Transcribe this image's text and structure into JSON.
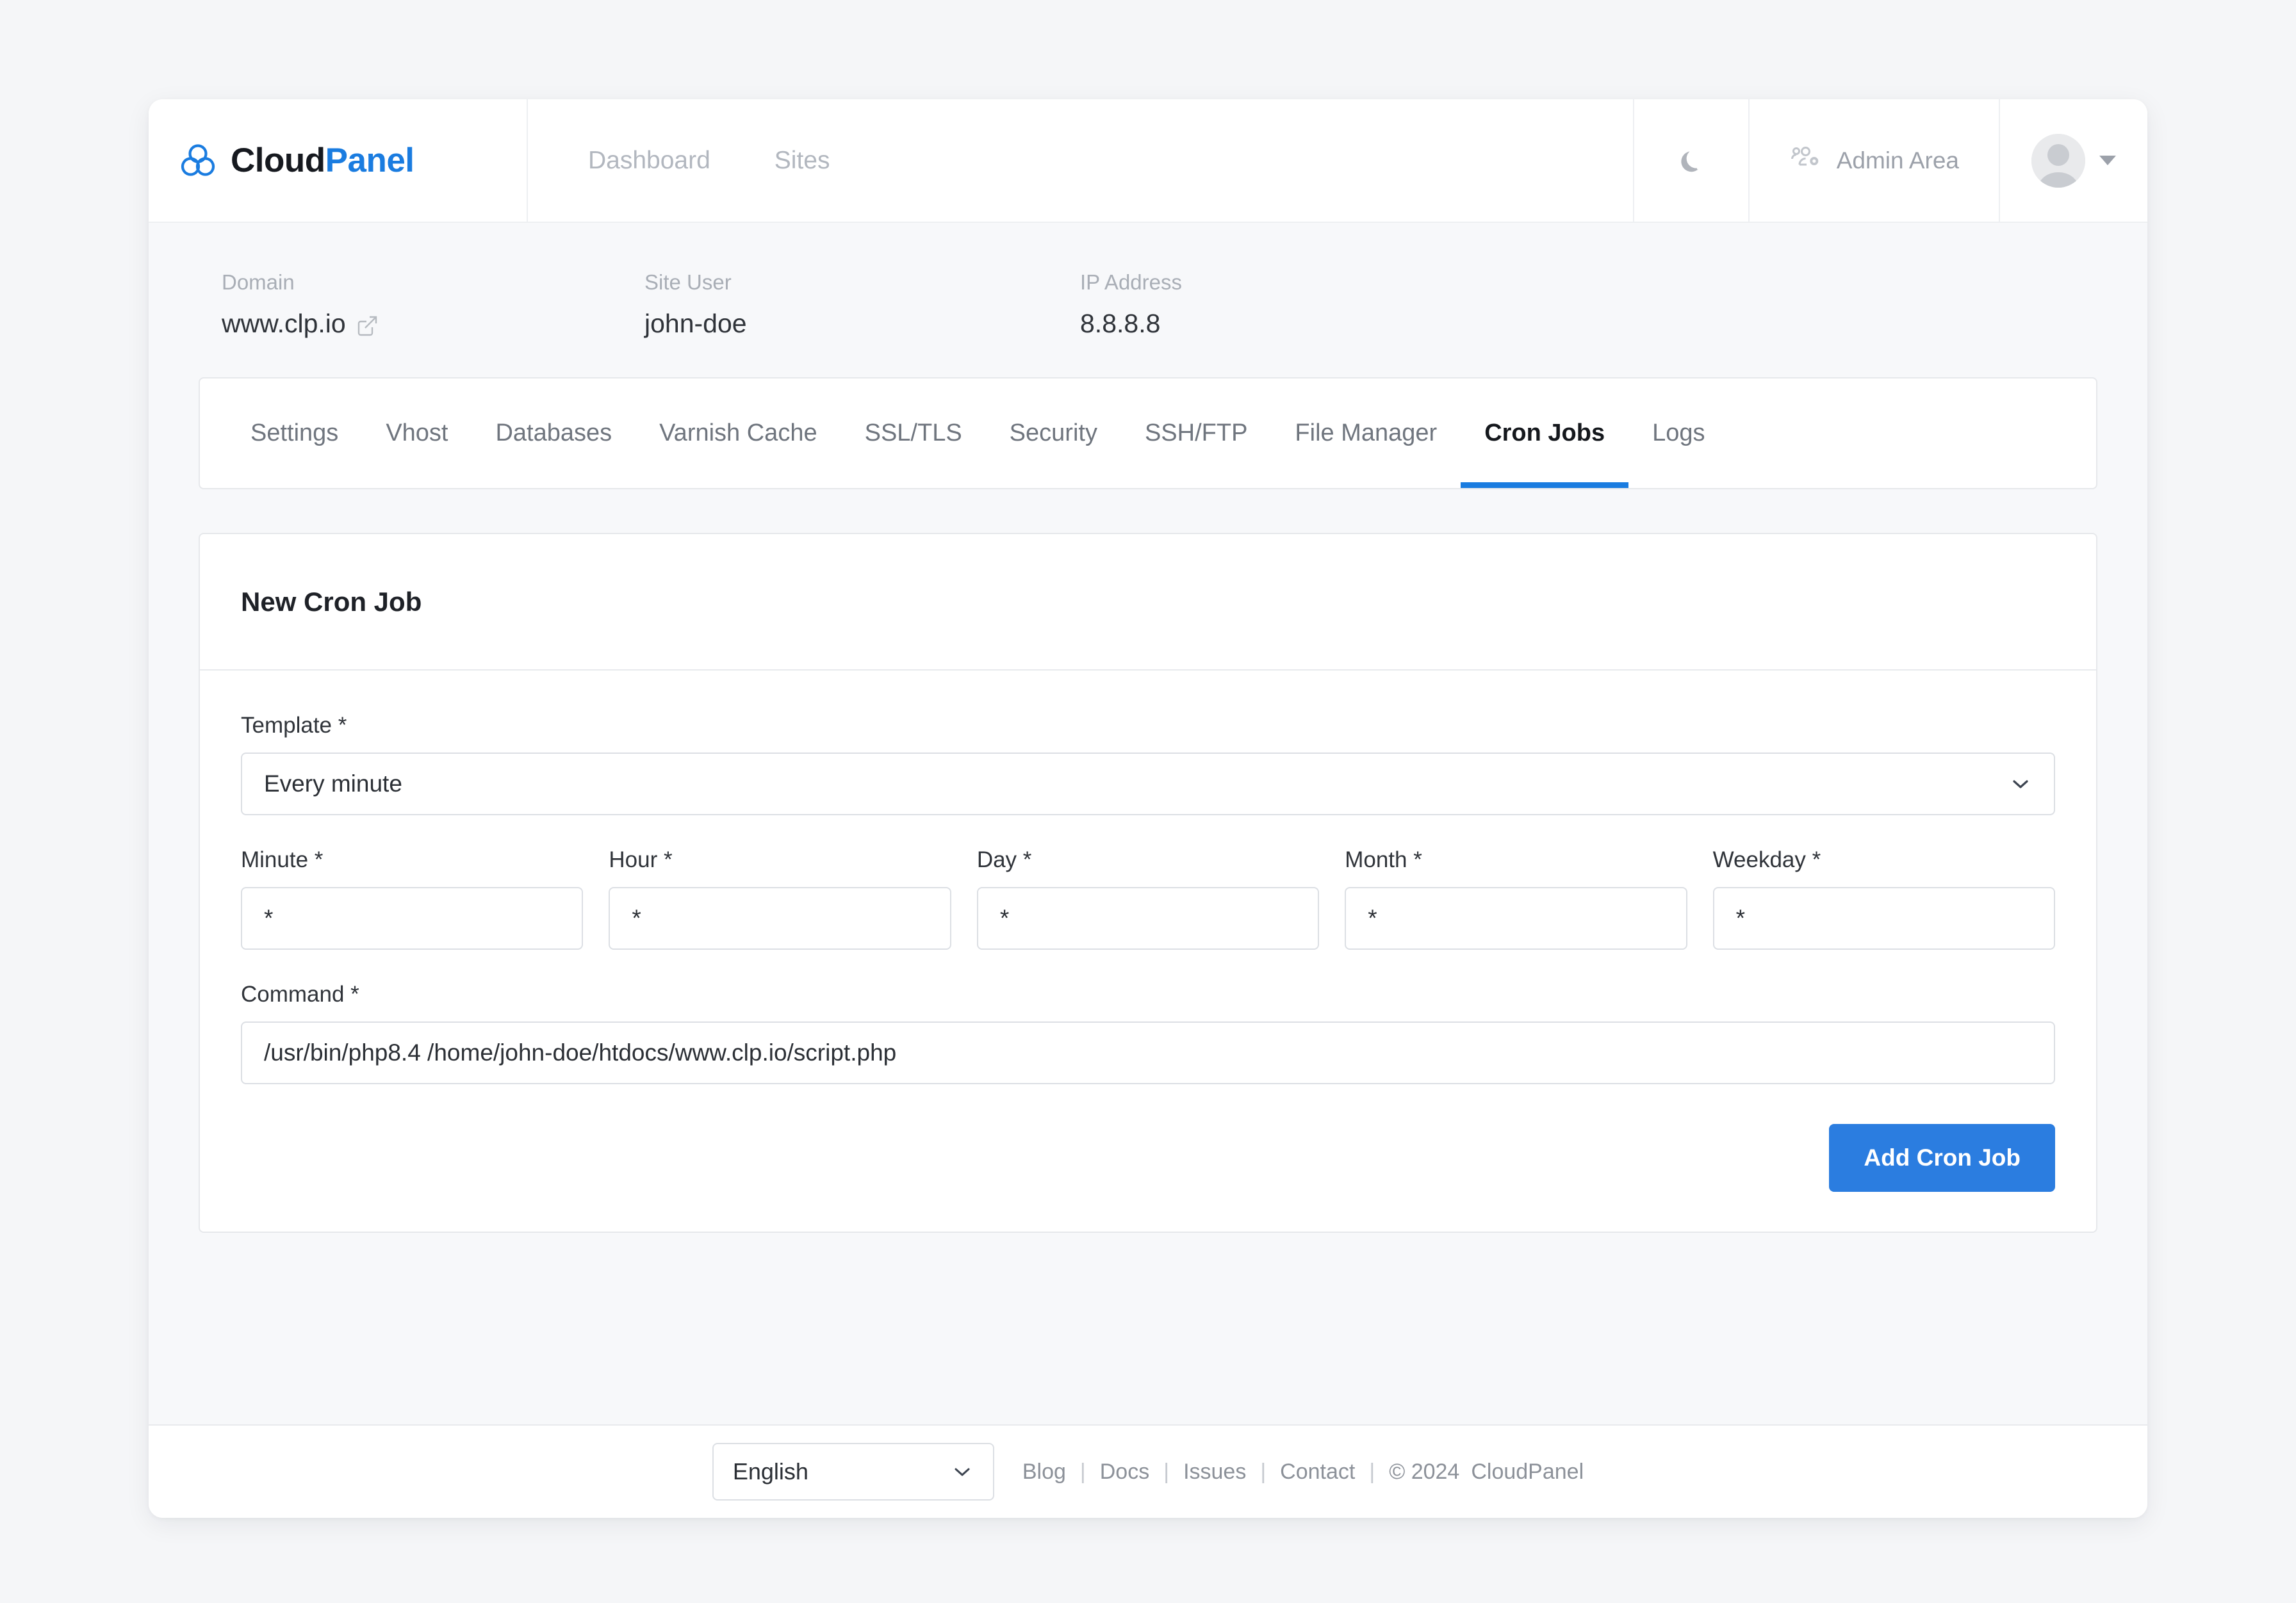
{
  "brand": {
    "name_part1": "Cloud",
    "name_part2": "Panel",
    "logo_icon": "cloud-trefoil-logo-icon",
    "accent_color": "#1a7ce0"
  },
  "header": {
    "nav": [
      {
        "label": "Dashboard",
        "name": "nav-dashboard"
      },
      {
        "label": "Sites",
        "name": "nav-sites"
      }
    ],
    "dark_mode_icon": "moon-icon",
    "admin_area": {
      "label": "Admin Area",
      "icon": "users-gear-icon"
    },
    "user_menu": {
      "avatar_icon": "avatar-icon",
      "caret_icon": "caret-down-icon"
    }
  },
  "site_info": [
    {
      "label": "Domain",
      "value": "www.clp.io",
      "icon": "external-link-icon"
    },
    {
      "label": "Site User",
      "value": "john-doe"
    },
    {
      "label": "IP Address",
      "value": "8.8.8.8"
    }
  ],
  "tabs": [
    {
      "label": "Settings",
      "active": false
    },
    {
      "label": "Vhost",
      "active": false
    },
    {
      "label": "Databases",
      "active": false
    },
    {
      "label": "Varnish Cache",
      "active": false
    },
    {
      "label": "SSL/TLS",
      "active": false
    },
    {
      "label": "Security",
      "active": false
    },
    {
      "label": "SSH/FTP",
      "active": false
    },
    {
      "label": "File Manager",
      "active": false
    },
    {
      "label": "Cron Jobs",
      "active": true
    },
    {
      "label": "Logs",
      "active": false
    }
  ],
  "card": {
    "title": "New Cron Job",
    "template": {
      "label": "Template *",
      "value": "Every minute",
      "chevron_icon": "chevron-down-icon"
    },
    "schedule_fields": [
      {
        "label": "Minute *",
        "value": "*",
        "name": "minute-input"
      },
      {
        "label": "Hour *",
        "value": "*",
        "name": "hour-input"
      },
      {
        "label": "Day *",
        "value": "*",
        "name": "day-input"
      },
      {
        "label": "Month *",
        "value": "*",
        "name": "month-input"
      },
      {
        "label": "Weekday *",
        "value": "*",
        "name": "weekday-input"
      }
    ],
    "command": {
      "label": "Command *",
      "value": "/usr/bin/php8.4 /home/john-doe/htdocs/www.clp.io/script.php"
    },
    "submit_label": "Add Cron Job",
    "submit_color": "#2b7de0"
  },
  "footer": {
    "language": {
      "value": "English",
      "chevron_icon": "chevron-down-icon"
    },
    "links": [
      {
        "label": "Blog"
      },
      {
        "label": "Docs"
      },
      {
        "label": "Issues"
      },
      {
        "label": "Contact"
      }
    ],
    "separator": "|",
    "copyright": "© 2024",
    "copyright_brand": "CloudPanel"
  }
}
